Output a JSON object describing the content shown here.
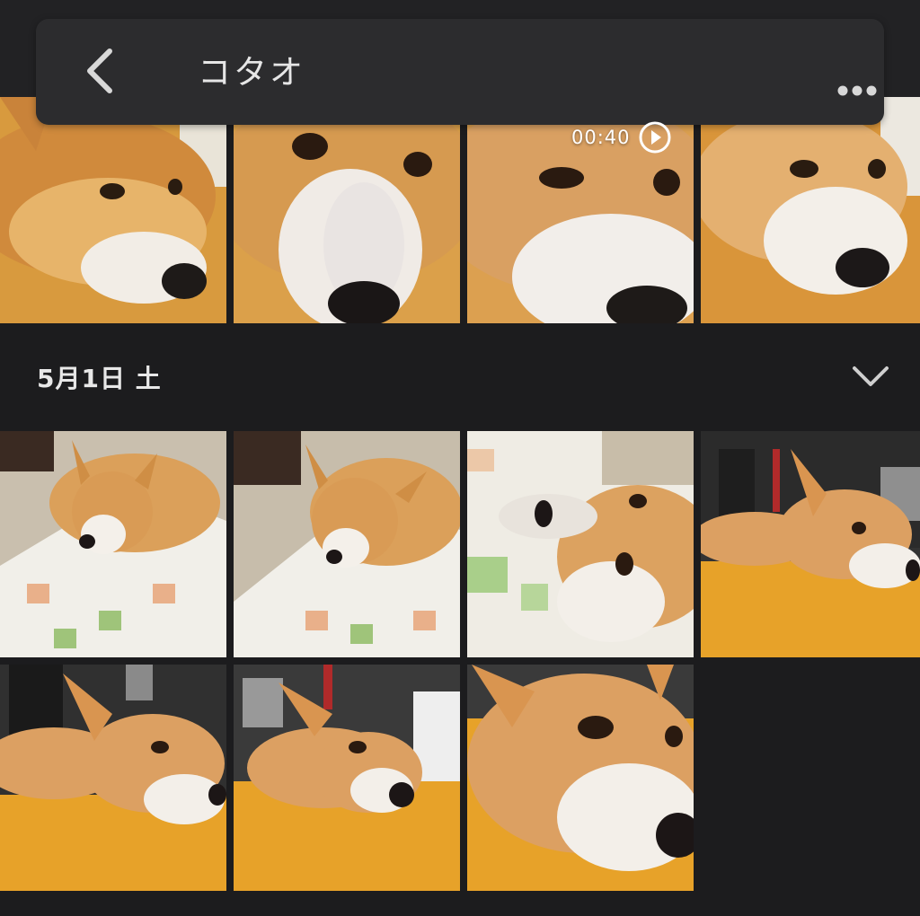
{
  "header": {
    "title": "コタオ",
    "back_icon": "chevron-left-icon",
    "more_icon": "more-dots-icon"
  },
  "section": {
    "date_label": "5月1日 土",
    "collapse_icon": "chevron-down-icon"
  },
  "video": {
    "duration": "00:40",
    "play_icon": "play-circle-icon"
  },
  "colors": {
    "background": "#1c1c1e",
    "bar": "#2c2c2e",
    "text": "#e8e8e8"
  }
}
